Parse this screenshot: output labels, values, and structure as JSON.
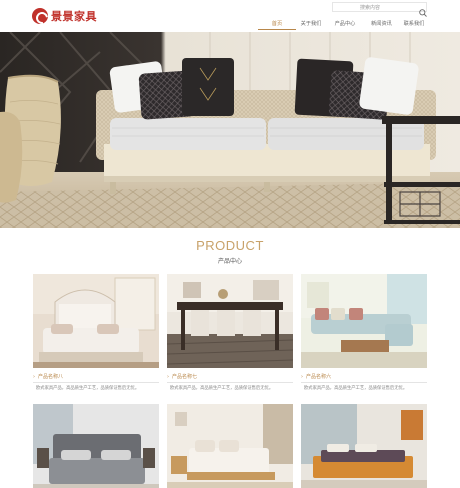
{
  "header": {
    "logo_text": "景景家具",
    "search_placeholder": "搜索内容",
    "nav": [
      {
        "label": "首页",
        "active": true
      },
      {
        "label": "关于我们",
        "active": false
      },
      {
        "label": "产品中心",
        "active": false
      },
      {
        "label": "新闻资讯",
        "active": false
      },
      {
        "label": "联系我们",
        "active": false
      }
    ]
  },
  "colors": {
    "brand_red": "#c0312b",
    "accent_gold": "#c8a26a",
    "nav_active": "#b8874a"
  },
  "product_section": {
    "title_en": "PRODUCT",
    "title_cn": "产品中心"
  },
  "products": [
    {
      "name": "产品名称八",
      "desc": "欧式家具产品，高品质生产工艺，品质保证售后无忧。"
    },
    {
      "name": "产品名称七",
      "desc": "欧式家具产品，高品质生产工艺，品质保证售后无忧。"
    },
    {
      "name": "产品名称六",
      "desc": "欧式家具产品，高品质生产工艺，品质保证售后无忧。"
    },
    {
      "name": "",
      "desc": ""
    },
    {
      "name": "",
      "desc": ""
    },
    {
      "name": "",
      "desc": ""
    }
  ]
}
